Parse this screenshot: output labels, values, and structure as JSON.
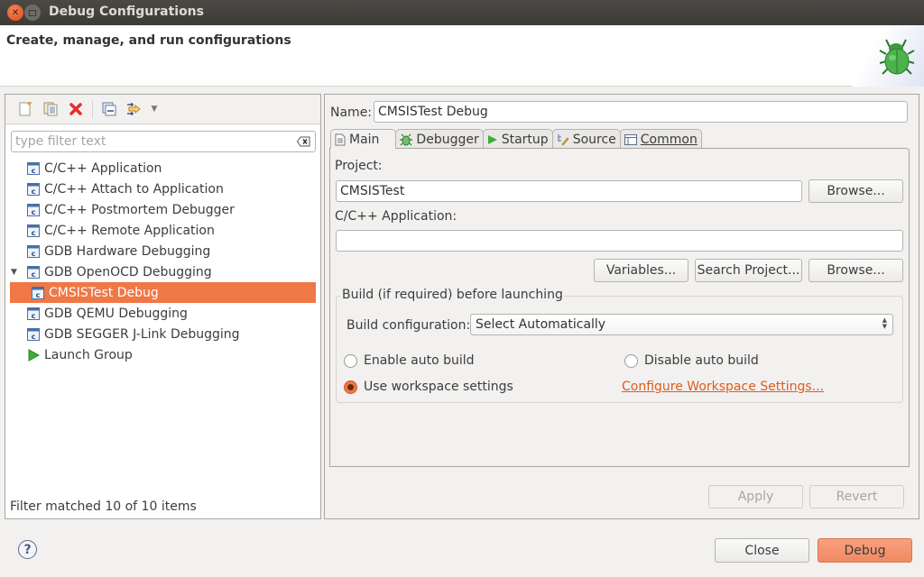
{
  "window": {
    "title": "Debug Configurations",
    "close_icon": "close-icon",
    "maximize_icon": "maximize-icon"
  },
  "banner": {
    "heading": "Create, manage, and run configurations",
    "image_icon": "bug-icon"
  },
  "left": {
    "toolbar": {
      "new_icon": "new-configuration-icon",
      "duplicate_icon": "duplicate-icon",
      "delete_icon": "delete-icon",
      "collapse_icon": "collapse-all-icon",
      "filter_icon": "filter-icon",
      "menu_icon": "dropdown-icon"
    },
    "filter": {
      "placeholder": "type filter text",
      "value": ""
    },
    "tree": [
      {
        "label": "C/C++ Application",
        "icon": "c-config-icon",
        "level": 0
      },
      {
        "label": "C/C++ Attach to Application",
        "icon": "c-config-icon",
        "level": 0
      },
      {
        "label": "C/C++ Postmortem Debugger",
        "icon": "c-config-icon",
        "level": 0
      },
      {
        "label": "C/C++ Remote Application",
        "icon": "c-config-icon",
        "level": 0
      },
      {
        "label": "GDB Hardware Debugging",
        "icon": "c-config-icon",
        "level": 0
      },
      {
        "label": "GDB OpenOCD Debugging",
        "icon": "c-config-icon",
        "level": 0,
        "expanded": true
      },
      {
        "label": "CMSISTest Debug",
        "icon": "c-config-icon",
        "level": 1,
        "selected": true
      },
      {
        "label": "GDB QEMU Debugging",
        "icon": "c-config-icon",
        "level": 0
      },
      {
        "label": "GDB SEGGER J-Link Debugging",
        "icon": "c-config-icon",
        "level": 0
      },
      {
        "label": "Launch Group",
        "icon": "launch-group-icon",
        "level": 0
      }
    ],
    "status": "Filter matched 10 of 10 items"
  },
  "right": {
    "name_label": "Name:",
    "name_value": "CMSISTest Debug",
    "tabs": [
      {
        "label": "Main",
        "icon": "main-tab-icon",
        "active": true
      },
      {
        "label": "Debugger",
        "icon": "debugger-tab-icon"
      },
      {
        "label": "Startup",
        "icon": "startup-tab-icon"
      },
      {
        "label": "Source",
        "icon": "source-tab-icon"
      },
      {
        "label": "Common",
        "icon": "common-tab-icon",
        "mnemonic": "C"
      }
    ],
    "main": {
      "project_label": "Project:",
      "project_value": "CMSISTest",
      "browse_label": "Browse...",
      "app_label": "C/C++ Application:",
      "app_value": "",
      "variables_label": "Variables...",
      "search_project_label": "Search Project...",
      "browse2_label": "Browse...",
      "build_group_title": "Build (if required) before launching",
      "build_config_label": "Build configuration:",
      "build_config_value": "Select Automatically",
      "radios": [
        {
          "label": "Enable auto build",
          "checked": false
        },
        {
          "label": "Disable auto build",
          "checked": false
        },
        {
          "label": "Use workspace settings",
          "checked": true
        }
      ],
      "configure_link": "Configure Workspace Settings..."
    },
    "apply_label": "Apply",
    "revert_label": "Revert"
  },
  "footer": {
    "help_icon": "help-icon",
    "close_label": "Close",
    "debug_label": "Debug"
  },
  "colors": {
    "accent": "#f07746",
    "link": "#e05a1c",
    "titlebar": "#3c3b37"
  }
}
